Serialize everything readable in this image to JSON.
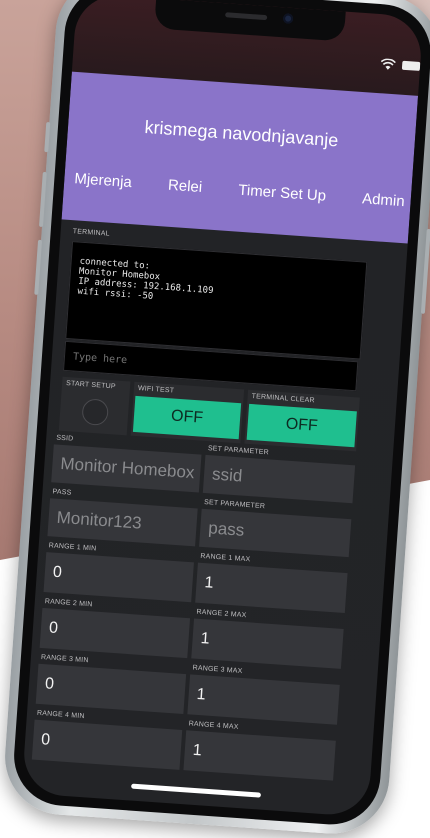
{
  "app": {
    "title": "krismega navodnjavanje"
  },
  "tabs": [
    {
      "label": "Mjerenja"
    },
    {
      "label": "Relei"
    },
    {
      "label": "Timer Set Up"
    },
    {
      "label": "Admin"
    }
  ],
  "terminal": {
    "label": "TERMINAL",
    "lines": [
      "connected to:",
      "Monitor Homebox",
      "IP address: 192.168.1.109",
      "wifi rssi: -50"
    ],
    "placeholder": "Type here"
  },
  "controls": {
    "start_setup_label": "START SETUP",
    "wifi_test_label": "WIFI TEST",
    "wifi_test_value": "OFF",
    "terminal_clear_label": "TERMINAL CLEAR",
    "terminal_clear_value": "OFF"
  },
  "ssid": {
    "label": "SSID",
    "value": "Monitor Homebox",
    "param_label": "SET PARAMETER",
    "param_value": "ssid"
  },
  "pass": {
    "label": "PASS",
    "value": "Monitor123",
    "param_label": "SET PARAMETER",
    "param_value": "pass"
  },
  "ranges": [
    {
      "min_label": "RANGE 1 MIN",
      "min_value": "0",
      "max_label": "RANGE 1 MAX",
      "max_value": "1"
    },
    {
      "min_label": "RANGE 2 MIN",
      "min_value": "0",
      "max_label": "RANGE 2 MAX",
      "max_value": "1"
    },
    {
      "min_label": "RANGE 3 MIN",
      "min_value": "0",
      "max_label": "RANGE 3 MAX",
      "max_value": "1"
    },
    {
      "min_label": "RANGE 4 MIN",
      "min_value": "0",
      "max_label": "RANGE 4 MAX",
      "max_value": "1"
    }
  ],
  "colors": {
    "header": "#8a74c9",
    "accent_green": "#1fbf8f",
    "background": "#232427"
  }
}
